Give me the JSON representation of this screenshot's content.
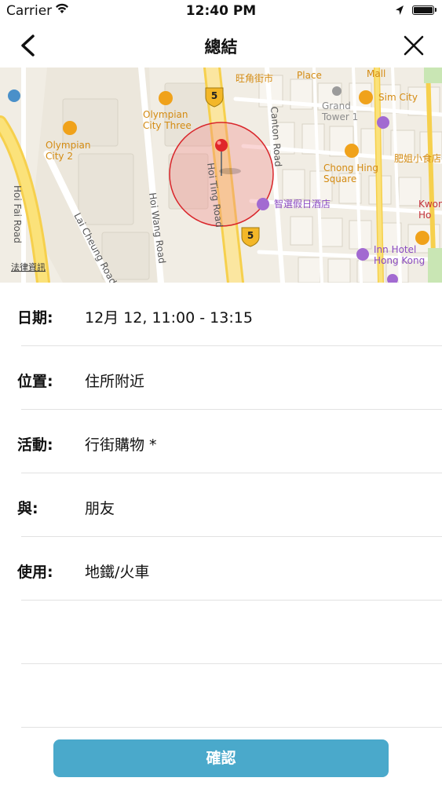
{
  "status_bar": {
    "carrier": "Carrier",
    "time": "12:40 PM"
  },
  "nav": {
    "title": "總結"
  },
  "map": {
    "legal_link": "法律資訊",
    "labels": {
      "wong_kok_street": "旺角街市",
      "place": "Place",
      "mall": "Mall",
      "grand_tower": "Grand\nTower 1",
      "sim_city": "Sim City",
      "olympian_three": "Olympian\nCity Three",
      "olympian_two": "Olympian\nCity 2",
      "canton_road": "Canton Road",
      "hoi_ting_road": "Hoi Ting Road",
      "hoi_wang_road": "Hoi Wang Road",
      "lai_cheung_road": "Lai Cheung Road",
      "hoi_fai_road": "Hoi Fai Road",
      "chong_hing": "Chong Hing\nSquare",
      "shop": "肥姐小食店",
      "hotel": "智選假日酒店",
      "inn": "Inn Hotel\nHong Kong",
      "kwon": "Kwon\nHo",
      "route": "5"
    }
  },
  "details": [
    {
      "label": "日期:",
      "value": "12月 12, 11:00 - 13:15"
    },
    {
      "label": "位置:",
      "value": "住所附近"
    },
    {
      "label": "活動:",
      "value": "行街購物 *"
    },
    {
      "label": "與:",
      "value": "朋友"
    },
    {
      "label": "使用:",
      "value": "地鐵/火車"
    },
    {
      "label": "",
      "value": ""
    },
    {
      "label": "",
      "value": ""
    }
  ],
  "confirm_button": "確認",
  "colors": {
    "accent": "#4aa9cb",
    "pin": "#e0262a",
    "map_poi": "#f0a21b"
  }
}
